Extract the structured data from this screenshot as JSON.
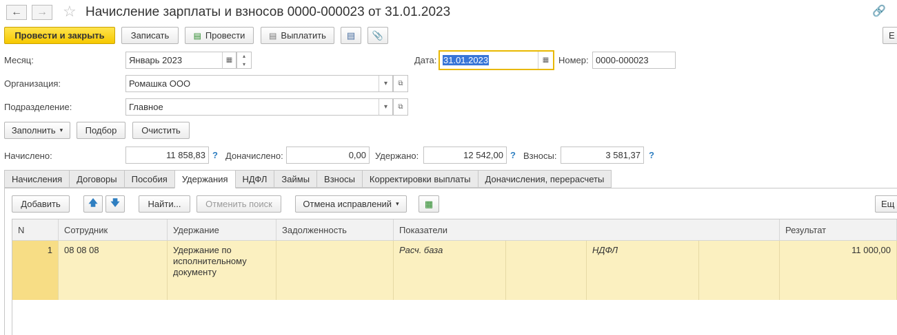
{
  "title": "Начисление зарплаты и взносов 0000-000023 от 31.01.2023",
  "toolbar": {
    "post_close": "Провести и закрыть",
    "save": "Записать",
    "post": "Провести",
    "pay": "Выплатить",
    "more_right": "Е"
  },
  "form": {
    "month_label": "Месяц:",
    "month_value": "Январь 2023",
    "date_label": "Дата:",
    "date_value": "31.01.2023",
    "number_label": "Номер:",
    "number_value": "0000-000023",
    "org_label": "Организация:",
    "org_value": "Ромашка ООО",
    "dept_label": "Подразделение:",
    "dept_value": "Главное"
  },
  "actions": {
    "fill": "Заполнить",
    "pick": "Подбор",
    "clear": "Очистить"
  },
  "totals": {
    "accrued_label": "Начислено:",
    "accrued_value": "11 858,83",
    "extra_label": "Доначислено:",
    "extra_value": "0,00",
    "withheld_label": "Удержано:",
    "withheld_value": "12 542,00",
    "contrib_label": "Взносы:",
    "contrib_value": "3 581,37",
    "help": "?"
  },
  "tabs": [
    "Начисления",
    "Договоры",
    "Пособия",
    "Удержания",
    "НДФЛ",
    "Займы",
    "Взносы",
    "Корректировки выплаты",
    "Доначисления, перерасчеты"
  ],
  "active_tab": "Удержания",
  "table_toolbar": {
    "add": "Добавить",
    "find": "Найти...",
    "cancel_search": "Отменить поиск",
    "cancel_corrections": "Отмена исправлений",
    "more_right": "Ещ"
  },
  "table": {
    "columns": [
      "N",
      "Сотрудник",
      "Удержание",
      "Задолженность",
      "Показатели",
      "Результат"
    ],
    "rows": [
      {
        "n": "1",
        "employee": "08 08 08",
        "deduction": "Удержание по исполнительному документу",
        "debt": "",
        "indicator1": "Расч. база",
        "indicator2": "НДФЛ",
        "result": "11 000,00"
      }
    ]
  },
  "colors": {
    "primary_button": "#f6c800",
    "selected_row": "#fbf0c0",
    "row_number_cell": "#f7dd85",
    "focus_border": "#e8b800",
    "help": "#2f7fc1"
  }
}
